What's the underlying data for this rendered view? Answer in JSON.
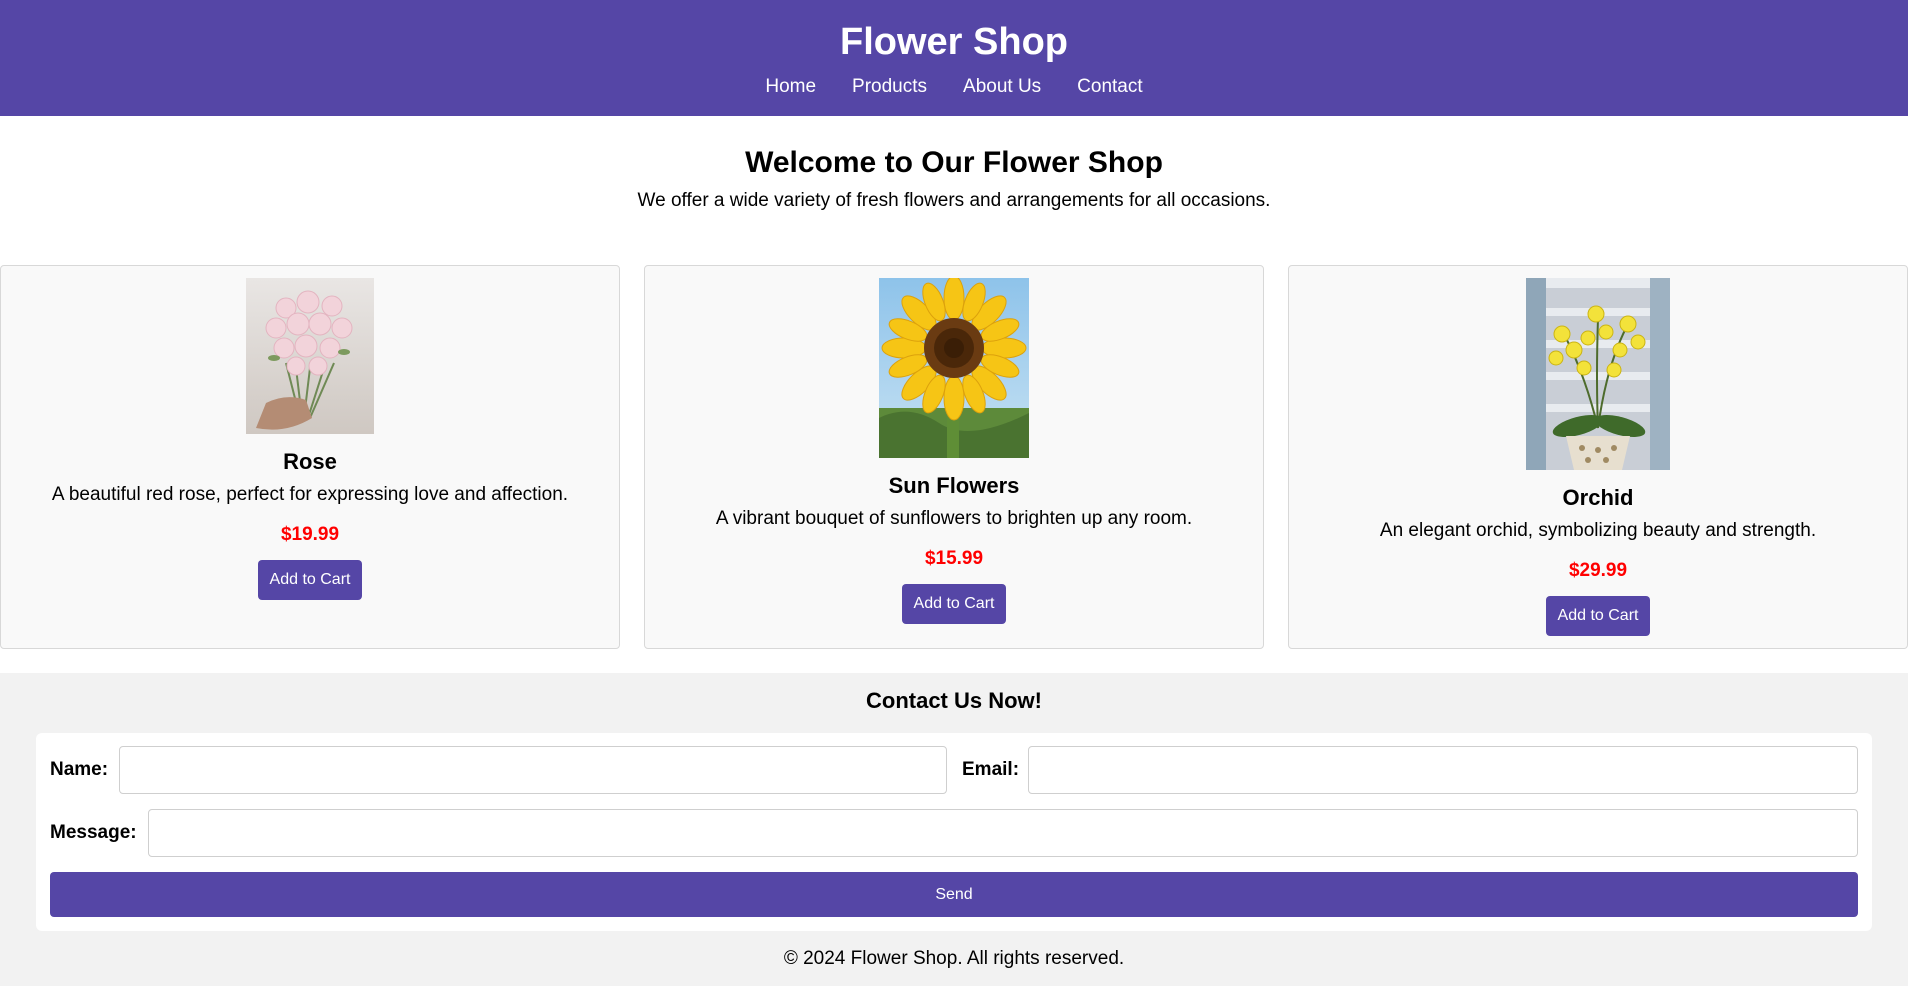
{
  "header": {
    "title": "Flower Shop",
    "nav": [
      "Home",
      "Products",
      "About Us",
      "Contact"
    ]
  },
  "intro": {
    "title": "Welcome to Our Flower Shop",
    "text": "We offer a wide variety of fresh flowers and arrangements for all occasions."
  },
  "products": [
    {
      "name": "Rose",
      "description": "A beautiful red rose, perfect for expressing love and affection.",
      "price": "$19.99",
      "button": "Add to Cart"
    },
    {
      "name": "Sun Flowers",
      "description": "A vibrant bouquet of sunflowers to brighten up any room.",
      "price": "$15.99",
      "button": "Add to Cart"
    },
    {
      "name": "Orchid",
      "description": "An elegant orchid, symbolizing beauty and strength.",
      "price": "$29.99",
      "button": "Add to Cart"
    }
  ],
  "contact": {
    "title": "Contact Us Now!",
    "name_label": "Name:",
    "name_value": "",
    "email_label": "Email:",
    "email_value": "",
    "message_label": "Message:",
    "message_value": "",
    "send_label": "Send"
  },
  "footer": {
    "text": "© 2024 Flower Shop. All rights reserved."
  },
  "colors": {
    "brand": "#5546a6",
    "price": "#ff0000",
    "card_bg": "#f9f9f9",
    "contact_bg": "#f2f2f2"
  }
}
